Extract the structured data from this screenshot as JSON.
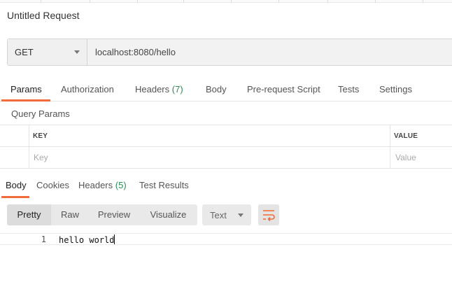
{
  "request": {
    "title": "Untitled Request",
    "method": "GET",
    "url": "localhost:8080/hello"
  },
  "request_tabs": [
    {
      "label": "Params",
      "count": ""
    },
    {
      "label": "Authorization",
      "count": ""
    },
    {
      "label": "Headers",
      "count": "(7)"
    },
    {
      "label": "Body",
      "count": ""
    },
    {
      "label": "Pre-request Script",
      "count": ""
    },
    {
      "label": "Tests",
      "count": ""
    },
    {
      "label": "Settings",
      "count": ""
    }
  ],
  "query_params": {
    "title": "Query Params",
    "key_header": "KEY",
    "value_header": "VALUE",
    "key_placeholder": "Key",
    "value_placeholder": "Value"
  },
  "response_tabs": [
    {
      "label": "Body",
      "count": ""
    },
    {
      "label": "Cookies",
      "count": ""
    },
    {
      "label": "Headers",
      "count": "(5)"
    },
    {
      "label": "Test Results",
      "count": ""
    }
  ],
  "response_view": {
    "modes": [
      "Pretty",
      "Raw",
      "Preview",
      "Visualize"
    ],
    "format": "Text",
    "wrap_icon": "wrap-lines-icon"
  },
  "response_body": {
    "line_number": "1",
    "text": "hello world"
  },
  "colors": {
    "accent": "#f26b3a",
    "count": "#2e8b57"
  }
}
